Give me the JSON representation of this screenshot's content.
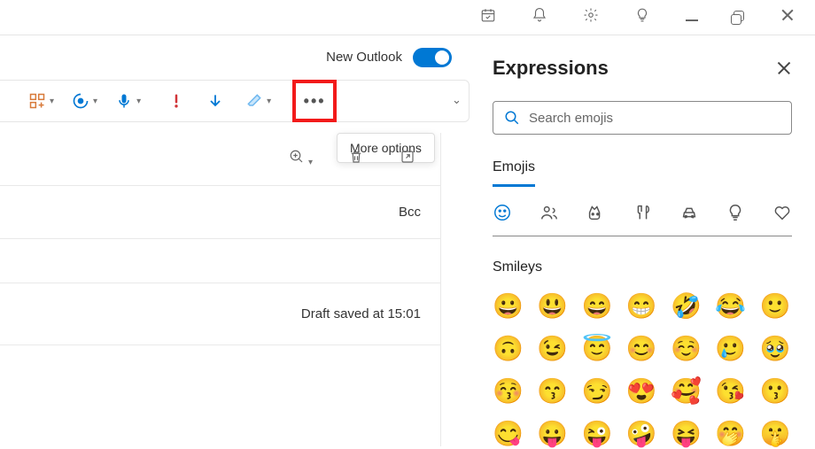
{
  "titleBar": {
    "icons": [
      "calendar-check",
      "bell",
      "gear",
      "lightbulb",
      "minimize",
      "restore",
      "close"
    ]
  },
  "newOutlook": {
    "label": "New Outlook",
    "enabled": true
  },
  "composeToolbar": {
    "tools": [
      "apps",
      "loop",
      "dictate",
      "priority-high",
      "arrow-down",
      "eraser"
    ],
    "moreTooltip": "More options"
  },
  "compose": {
    "bccLabel": "Bcc",
    "draftStatus": "Draft saved at 15:01"
  },
  "expressions": {
    "title": "Expressions",
    "searchPlaceholder": "Search emojis",
    "tabLabel": "Emojis",
    "categories": [
      "smileys",
      "people",
      "animals",
      "food",
      "travel",
      "objects",
      "symbols"
    ],
    "sectionLabel": "Smileys",
    "emojis": [
      "😀",
      "😃",
      "😄",
      "😁",
      "🤣",
      "😂",
      "🙂",
      "🙃",
      "😉",
      "😇",
      "😊",
      "☺️",
      "🥲",
      "🥹",
      "😚",
      "😙",
      "😏",
      "😍",
      "🥰",
      "😘",
      "😗",
      "😋",
      "😛",
      "😜",
      "🤪",
      "😝",
      "🤭",
      "🤫"
    ]
  }
}
